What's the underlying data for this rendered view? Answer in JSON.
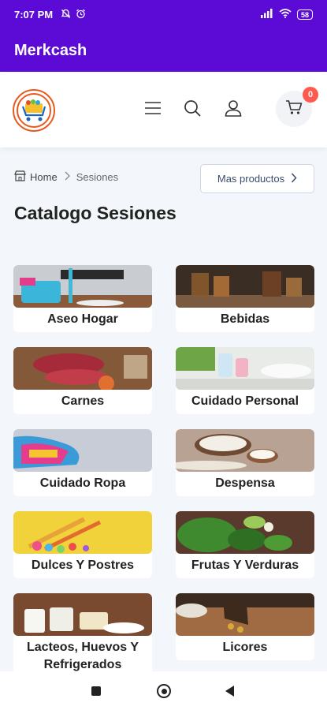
{
  "status_bar": {
    "time": "7:07 PM",
    "left_icons": [
      "silent-icon",
      "alarm-icon"
    ],
    "right_icons": [
      "signal-icon",
      "wifi-icon"
    ],
    "battery": "58"
  },
  "app_bar": {
    "title": "Merkcash"
  },
  "header": {
    "icons": [
      "menu-icon",
      "search-icon",
      "user-icon",
      "cart-icon"
    ],
    "cart_count": "0"
  },
  "breadcrumb": {
    "home": "Home",
    "current": "Sesiones"
  },
  "more_button": {
    "label": "Mas productos"
  },
  "page_title": "Catalogo Sesiones",
  "categories": [
    {
      "name": "Aseo Hogar"
    },
    {
      "name": "Bebidas"
    },
    {
      "name": "Carnes"
    },
    {
      "name": "Cuidado Personal"
    },
    {
      "name": "Cuidado Ropa"
    },
    {
      "name": "Despensa"
    },
    {
      "name": "Dulces Y Postres"
    },
    {
      "name": "Frutas Y Verduras"
    },
    {
      "name": "Lacteos, Huevos Y Refrigerados"
    },
    {
      "name": "Licores"
    }
  ],
  "colors": {
    "brand": "#5c0ad6",
    "badge": "#ff5a4e",
    "background": "#f3f6fa"
  }
}
